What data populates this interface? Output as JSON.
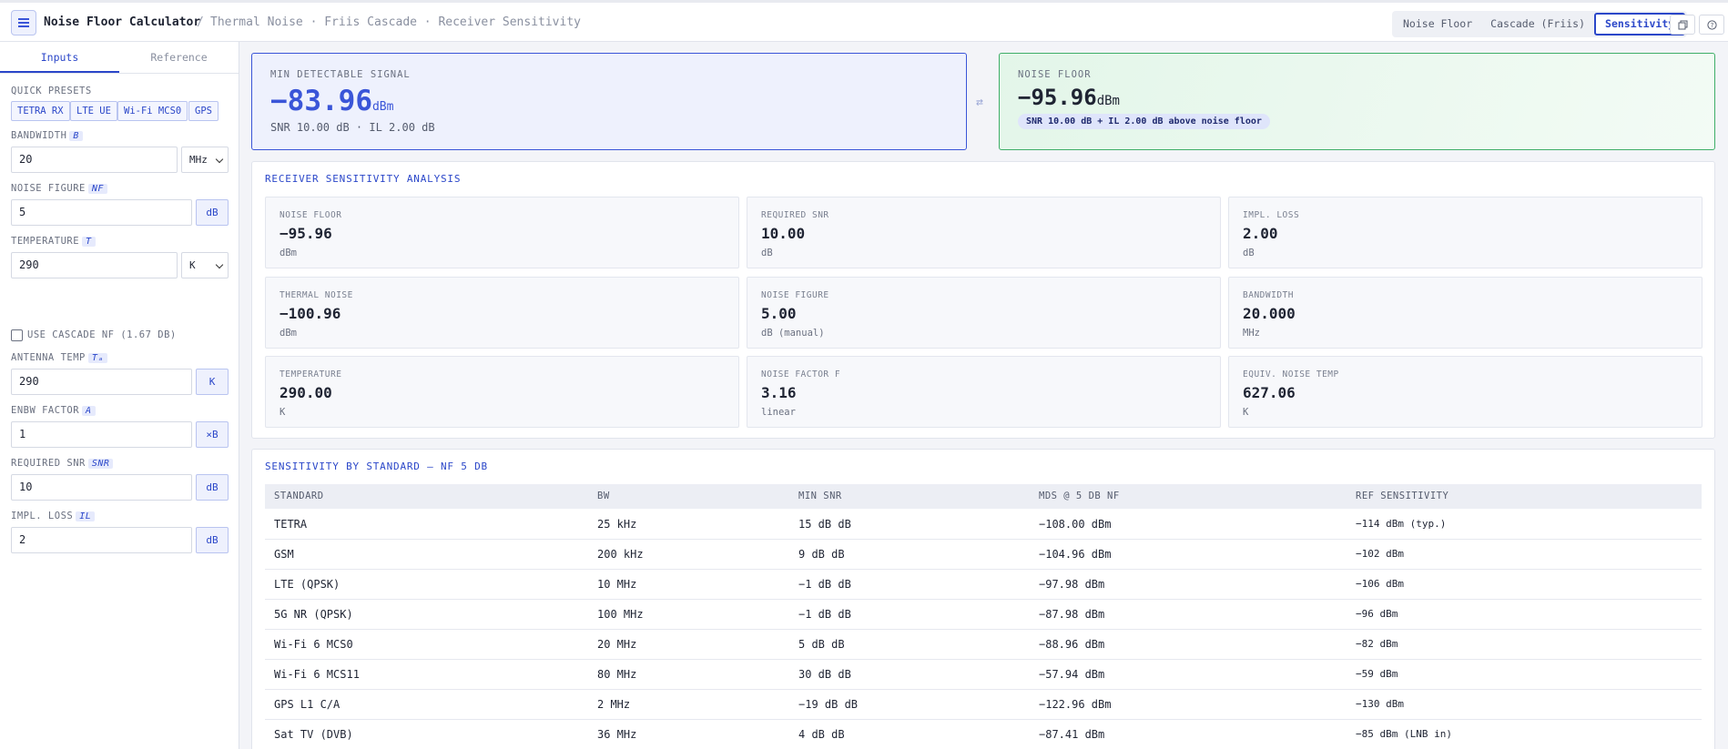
{
  "header": {
    "title": "Noise Floor Calculator",
    "separator": "/",
    "breadcrumb": "Thermal Noise · Friis Cascade · Receiver Sensitivity",
    "modes": [
      "Noise Floor",
      "Cascade (Friis)",
      "Sensitivity"
    ],
    "active_mode": "Sensitivity"
  },
  "icons": [
    "menu-icon",
    "copy-icon",
    "help-icon",
    "swap-icon"
  ],
  "sidebar": {
    "tabs": [
      "Inputs",
      "Reference"
    ],
    "presets_label": "QUICK PRESETS",
    "presets": [
      "TETRA RX",
      "LTE UE",
      "Wi-Fi MCS0",
      "GPS"
    ],
    "bandwidth": {
      "label": "BANDWIDTH",
      "symbol": "B",
      "value": "20",
      "unit": "MHz"
    },
    "noise_figure": {
      "label": "NOISE FIGURE",
      "symbol": "NF",
      "value": "5",
      "unit": "dB"
    },
    "temperature": {
      "label": "TEMPERATURE",
      "symbol": "T",
      "value": "290",
      "unit": "K"
    },
    "cascade_checkbox": "USE CASCADE NF (1.67 DB)",
    "antenna_temp": {
      "label": "ANTENNA TEMP",
      "symbol": "Tₐ",
      "value": "290",
      "unit": "K"
    },
    "enbw_factor": {
      "label": "ENBW FACTOR",
      "symbol": "A",
      "value": "1",
      "unit": "×B"
    },
    "required_snr": {
      "label": "REQUIRED SNR",
      "symbol": "SNR",
      "value": "10",
      "unit": "dB"
    },
    "impl_loss": {
      "label": "IMPL. LOSS",
      "symbol": "IL",
      "value": "2",
      "unit": "dB"
    }
  },
  "hero": {
    "mds_label": "MIN DETECTABLE SIGNAL",
    "mds_value": "−83.96",
    "mds_unit": "dBm",
    "mds_sub": "SNR 10.00 dB · IL 2.00 dB",
    "nf_label": "NOISE FLOOR",
    "nf_value": "−95.96",
    "nf_unit": "dBm",
    "nf_badge": "SNR 10.00 dB + IL 2.00 dB above noise floor"
  },
  "analysis": {
    "title": "RECEIVER SENSITIVITY ANALYSIS",
    "cards": [
      {
        "label": "NOISE FLOOR",
        "value": "−95.96",
        "unit": "dBm"
      },
      {
        "label": "REQUIRED SNR",
        "value": "10.00",
        "unit": "dB"
      },
      {
        "label": "IMPL. LOSS",
        "value": "2.00",
        "unit": "dB"
      },
      {
        "label": "THERMAL NOISE",
        "value": "−100.96",
        "unit": "dBm"
      },
      {
        "label": "NOISE FIGURE",
        "value": "5.00",
        "unit": "dB (manual)"
      },
      {
        "label": "BANDWIDTH",
        "value": "20.000",
        "unit": "MHz"
      },
      {
        "label": "TEMPERATURE",
        "value": "290.00",
        "unit": "K"
      },
      {
        "label": "NOISE FACTOR F",
        "value": "3.16",
        "unit": "linear"
      },
      {
        "label": "EQUIV. NOISE TEMP",
        "value": "627.06",
        "unit": "K"
      }
    ]
  },
  "standards": {
    "title": "SENSITIVITY BY STANDARD — NF 5 DB",
    "columns": [
      "STANDARD",
      "BW",
      "MIN SNR",
      "MDS @ 5 DB NF",
      "REF SENSITIVITY"
    ],
    "rows": [
      [
        "TETRA",
        "25 kHz",
        "15 dB dB",
        "−108.00 dBm",
        "−114 dBm (typ.)"
      ],
      [
        "GSM",
        "200 kHz",
        "9 dB dB",
        "−104.96 dBm",
        "−102 dBm"
      ],
      [
        "LTE (QPSK)",
        "10 MHz",
        "−1 dB dB",
        "−97.98 dBm",
        "−106 dBm"
      ],
      [
        "5G NR (QPSK)",
        "100 MHz",
        "−1 dB dB",
        "−87.98 dBm",
        "−96 dBm"
      ],
      [
        "Wi-Fi 6 MCS0",
        "20 MHz",
        "5 dB dB",
        "−88.96 dBm",
        "−82 dBm"
      ],
      [
        "Wi-Fi 6 MCS11",
        "80 MHz",
        "30 dB dB",
        "−57.94 dBm",
        "−59 dBm"
      ],
      [
        "GPS L1 C/A",
        "2 MHz",
        "−19 dB dB",
        "−122.96 dBm",
        "−130 dBm"
      ],
      [
        "Sat TV (DVB)",
        "36 MHz",
        "4 dB dB",
        "−87.41 dBm",
        "−85 dBm (LNB in)"
      ]
    ]
  }
}
